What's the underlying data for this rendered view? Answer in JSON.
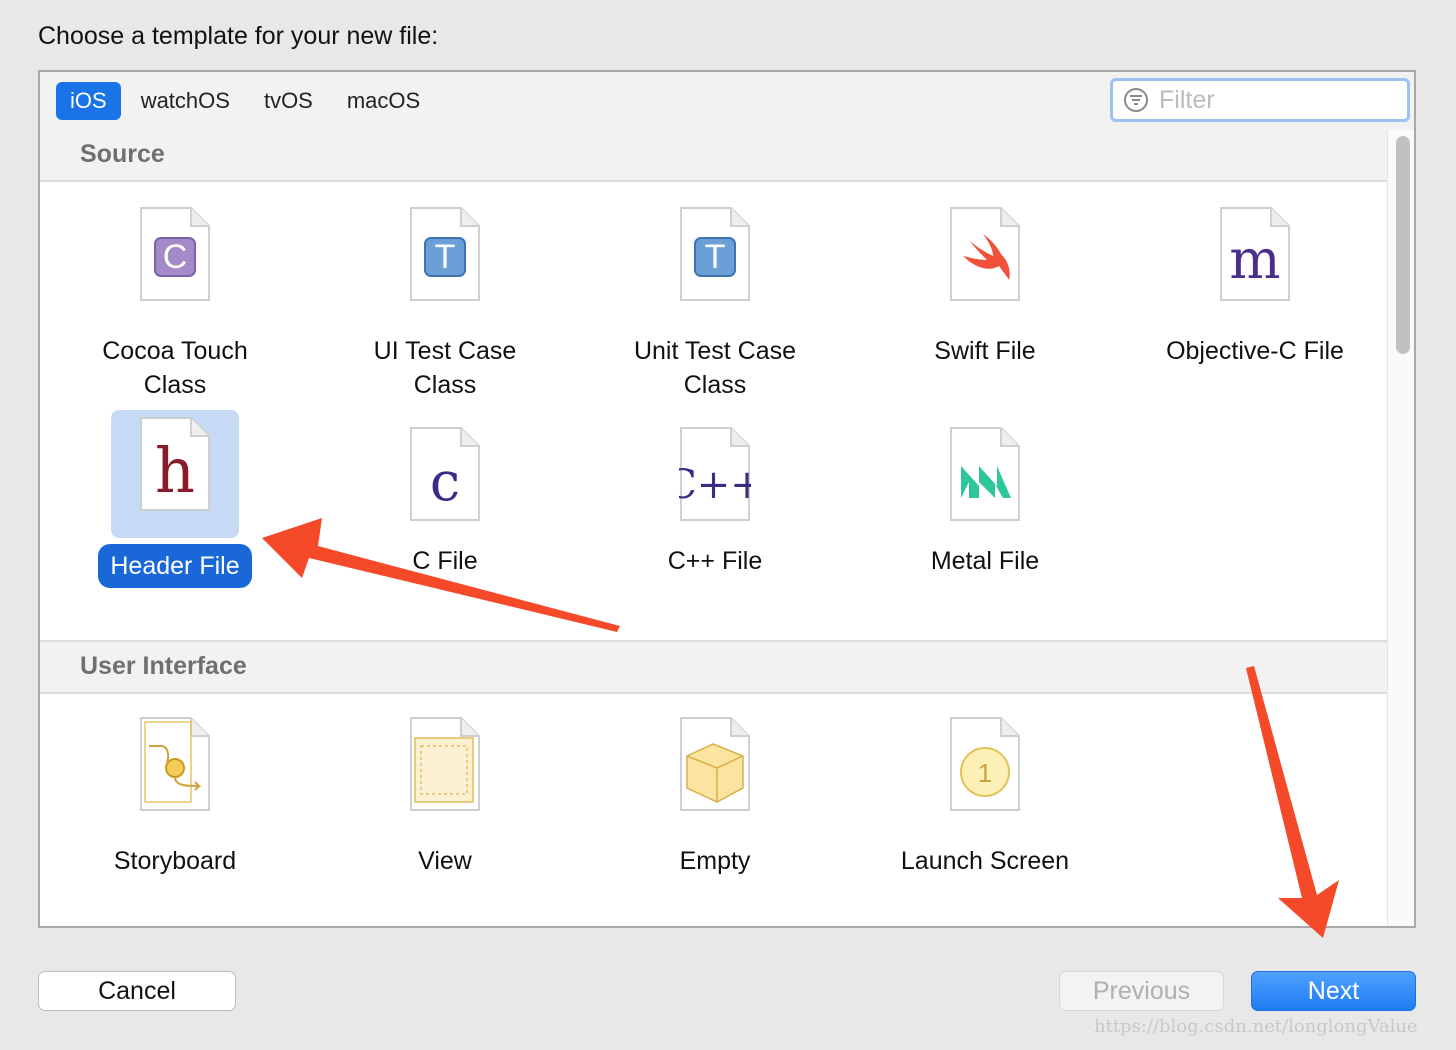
{
  "prompt": "Choose a template for your new file:",
  "tabs": [
    {
      "label": "iOS",
      "active": true
    },
    {
      "label": "watchOS",
      "active": false
    },
    {
      "label": "tvOS",
      "active": false
    },
    {
      "label": "macOS",
      "active": false
    }
  ],
  "filter": {
    "placeholder": "Filter",
    "icon": "filter-icon"
  },
  "sections": {
    "source": {
      "title": "Source",
      "items": [
        {
          "label": "Cocoa Touch\nClass",
          "icon": "cocoa-touch-class-icon",
          "glyph": "C"
        },
        {
          "label": "UI Test Case\nClass",
          "icon": "ui-test-case-icon",
          "glyph": "T"
        },
        {
          "label": "Unit Test Case\nClass",
          "icon": "unit-test-case-icon",
          "glyph": "T"
        },
        {
          "label": "Swift File",
          "icon": "swift-icon",
          "glyph": ""
        },
        {
          "label": "Objective-C File",
          "icon": "objective-c-icon",
          "glyph": "m"
        },
        {
          "label": "Header File",
          "icon": "header-file-icon",
          "glyph": "h",
          "selected": true
        },
        {
          "label": "C File",
          "icon": "c-file-icon",
          "glyph": "c"
        },
        {
          "label": "C++ File",
          "icon": "cpp-file-icon",
          "glyph": "C++"
        },
        {
          "label": "Metal File",
          "icon": "metal-icon",
          "glyph": ""
        }
      ]
    },
    "ui": {
      "title": "User Interface",
      "items": [
        {
          "label": "Storyboard",
          "icon": "storyboard-icon"
        },
        {
          "label": "View",
          "icon": "view-icon"
        },
        {
          "label": "Empty",
          "icon": "empty-icon"
        },
        {
          "label": "Launch Screen",
          "icon": "launch-screen-icon",
          "glyph": "1"
        }
      ]
    }
  },
  "buttons": {
    "cancel": "Cancel",
    "previous": "Previous",
    "next": "Next"
  },
  "watermark": "https://blog.csdn.net/longlongValue",
  "colors": {
    "accent": "#1a74e8",
    "selection_bg": "#c6daf5",
    "annotation_arrow": "#f44a2a"
  }
}
